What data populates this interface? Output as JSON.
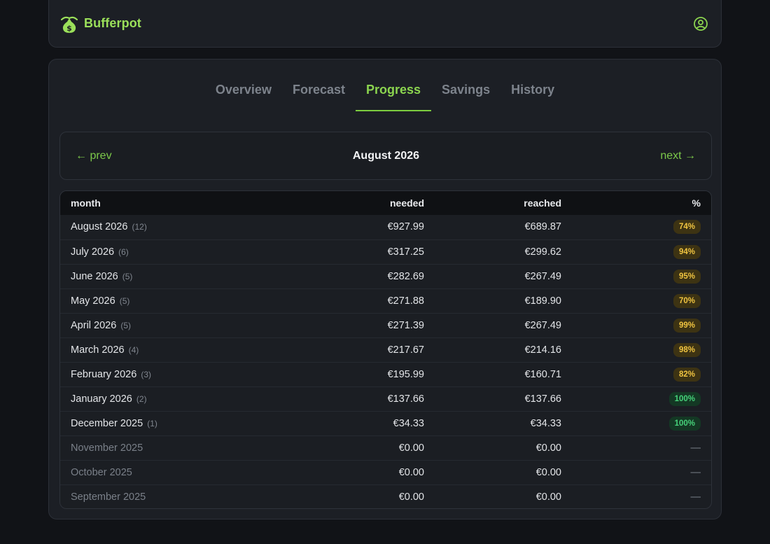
{
  "app": {
    "name": "Bufferpot"
  },
  "tabs": [
    {
      "label": "Overview",
      "active": false
    },
    {
      "label": "Forecast",
      "active": false
    },
    {
      "label": "Progress",
      "active": true
    },
    {
      "label": "Savings",
      "active": false
    },
    {
      "label": "History",
      "active": false
    }
  ],
  "monthnav": {
    "prev": "← prev",
    "title": "August 2026",
    "next": "next →"
  },
  "table": {
    "headers": {
      "month": "month",
      "needed": "needed",
      "reached": "reached",
      "pct": "%"
    },
    "rows": [
      {
        "month": "August 2026",
        "count": "(12)",
        "needed": "€927.99",
        "reached": "€689.87",
        "pct": "74%",
        "status": "warn"
      },
      {
        "month": "July 2026",
        "count": "(6)",
        "needed": "€317.25",
        "reached": "€299.62",
        "pct": "94%",
        "status": "warn"
      },
      {
        "month": "June 2026",
        "count": "(5)",
        "needed": "€282.69",
        "reached": "€267.49",
        "pct": "95%",
        "status": "warn"
      },
      {
        "month": "May 2026",
        "count": "(5)",
        "needed": "€271.88",
        "reached": "€189.90",
        "pct": "70%",
        "status": "warn"
      },
      {
        "month": "April 2026",
        "count": "(5)",
        "needed": "€271.39",
        "reached": "€267.49",
        "pct": "99%",
        "status": "warn"
      },
      {
        "month": "March 2026",
        "count": "(4)",
        "needed": "€217.67",
        "reached": "€214.16",
        "pct": "98%",
        "status": "warn"
      },
      {
        "month": "February 2026",
        "count": "(3)",
        "needed": "€195.99",
        "reached": "€160.71",
        "pct": "82%",
        "status": "warn"
      },
      {
        "month": "January 2026",
        "count": "(2)",
        "needed": "€137.66",
        "reached": "€137.66",
        "pct": "100%",
        "status": "ok"
      },
      {
        "month": "December 2025",
        "count": "(1)",
        "needed": "€34.33",
        "reached": "€34.33",
        "pct": "100%",
        "status": "ok"
      },
      {
        "month": "November 2025",
        "count": "",
        "needed": "€0.00",
        "reached": "€0.00",
        "pct": "—",
        "status": "empty"
      },
      {
        "month": "October 2025",
        "count": "",
        "needed": "€0.00",
        "reached": "€0.00",
        "pct": "—",
        "status": "empty"
      },
      {
        "month": "September 2025",
        "count": "",
        "needed": "€0.00",
        "reached": "€0.00",
        "pct": "—",
        "status": "empty"
      }
    ]
  },
  "icons": {
    "brand": "money-bag-icon",
    "user": "user-circle-icon"
  },
  "colors": {
    "accent": "#8bd44f",
    "warn_badge": "#f0c440",
    "ok_badge": "#46d27a",
    "background": "#111317",
    "surface": "#1c1f25"
  }
}
